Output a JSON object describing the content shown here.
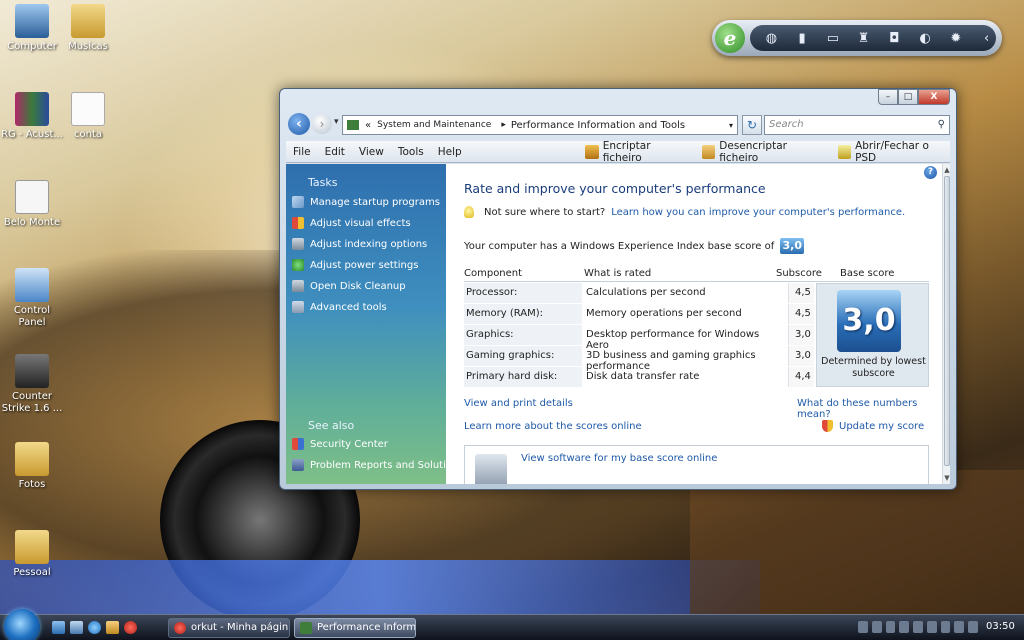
{
  "desktop": {
    "icons": [
      {
        "label": "Computer"
      },
      {
        "label": "Musicas"
      },
      {
        "label": "RG - Acust..."
      },
      {
        "label": "conta"
      },
      {
        "label": "Belo Monte"
      },
      {
        "label": "Control Panel"
      },
      {
        "label": "Counter Strike 1.6 ..."
      },
      {
        "label": "Fotos"
      },
      {
        "label": "Pessoal"
      }
    ]
  },
  "gadget": {
    "logo_letter": "e",
    "icons": [
      "globe-icon",
      "battery-icon",
      "radio-icon",
      "signal-icon",
      "lock-icon",
      "moon-icon",
      "gear-icon",
      "arrow-icon"
    ]
  },
  "window": {
    "controls": {
      "minimize": "–",
      "maximize": "□",
      "close": "X"
    },
    "address": {
      "prefix": "«",
      "crumb1": "System and Maintenance",
      "separator": "▸",
      "crumb2": "Performance Information and Tools"
    },
    "search_placeholder": "Search",
    "menu": [
      "File",
      "Edit",
      "View",
      "Tools",
      "Help"
    ],
    "toolbar": [
      {
        "label": "Encriptar ficheiro",
        "icon": "lock-icon"
      },
      {
        "label": "Desencriptar ficheiro",
        "icon": "unlock-icon"
      },
      {
        "label": "Abrir/Fechar o PSD",
        "icon": "psd-icon"
      }
    ]
  },
  "left_pane": {
    "tasks_title": "Tasks",
    "tasks": [
      {
        "label": "Manage startup programs",
        "icon": "grid-icon"
      },
      {
        "label": "Adjust visual effects",
        "icon": "shield-icon"
      },
      {
        "label": "Adjust indexing options",
        "icon": "disk-icon"
      },
      {
        "label": "Adjust power settings",
        "icon": "power-icon"
      },
      {
        "label": "Open Disk Cleanup",
        "icon": "disk-icon"
      },
      {
        "label": "Advanced tools",
        "icon": "tools-icon"
      }
    ],
    "see_also_title": "See also",
    "see_also": [
      {
        "label": "Security Center",
        "icon": "security-center-icon"
      },
      {
        "label": "Problem Reports and Solutions",
        "icon": "problem-reports-icon"
      }
    ]
  },
  "main": {
    "title": "Rate and improve your computer's performance",
    "hint_text": "Not sure where to start?",
    "hint_link": "Learn how you can improve your computer's performance.",
    "wei_text": "Your computer has a Windows Experience Index base score of",
    "wei_score": "3,0",
    "table": {
      "headers": [
        "Component",
        "What is rated",
        "Subscore",
        "Base score"
      ],
      "rows": [
        {
          "component": "Processor:",
          "rated": "Calculations per second",
          "subscore": "4,5"
        },
        {
          "component": "Memory (RAM):",
          "rated": "Memory operations per second",
          "subscore": "4,5"
        },
        {
          "component": "Graphics:",
          "rated": "Desktop performance for Windows Aero",
          "subscore": "3,0"
        },
        {
          "component": "Gaming graphics:",
          "rated": "3D business and gaming graphics performance",
          "subscore": "3,0"
        },
        {
          "component": "Primary hard disk:",
          "rated": "Disk data transfer rate",
          "subscore": "4,4"
        }
      ],
      "base_score": "3,0",
      "base_caption": "Determined by lowest subscore"
    },
    "links": {
      "view_print": "View and print details",
      "what_numbers": "What do these numbers mean?",
      "learn_more": "Learn more about the scores online",
      "update": "Update my score",
      "view_software": "View software for my base score online"
    }
  },
  "taskbar": {
    "buttons": [
      {
        "label": "orkut - Minha págin..."
      },
      {
        "label": "Performance Inform..."
      }
    ],
    "clock": "03:50"
  }
}
